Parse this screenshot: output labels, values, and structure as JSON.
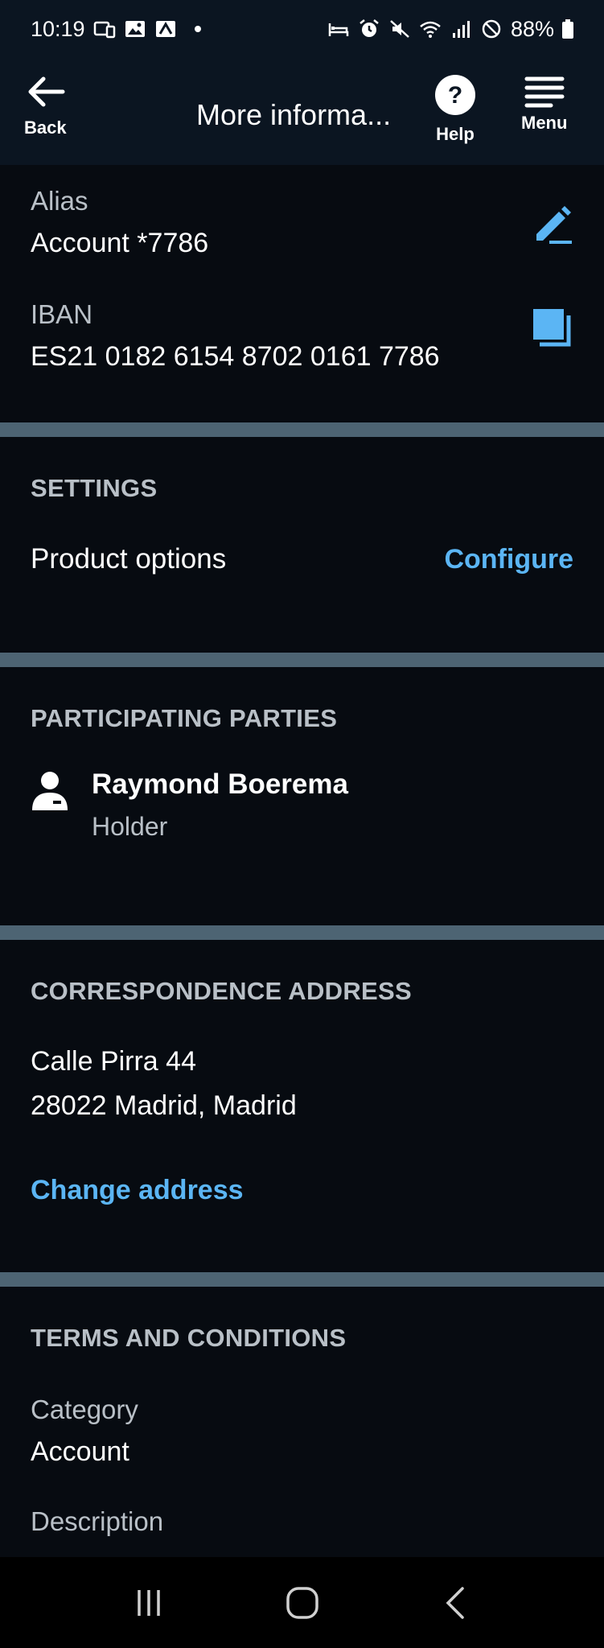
{
  "status_bar": {
    "time": "10:19",
    "battery": "88%"
  },
  "header": {
    "back_label": "Back",
    "title": "More informa...",
    "help_label": "Help",
    "menu_label": "Menu"
  },
  "account": {
    "alias_label": "Alias",
    "alias_value": "Account *7786",
    "iban_label": "IBAN",
    "iban_value": "ES21 0182 6154 8702 0161 7786"
  },
  "settings": {
    "heading": "SETTINGS",
    "product_options_label": "Product options",
    "configure_label": "Configure"
  },
  "parties": {
    "heading": "PARTICIPATING PARTIES",
    "name": "Raymond Boerema",
    "role": "Holder"
  },
  "correspondence": {
    "heading": "CORRESPONDENCE ADDRESS",
    "line1": "Calle Pirra 44",
    "line2": "28022 Madrid, Madrid",
    "change_label": "Change address"
  },
  "terms": {
    "heading": "TERMS AND CONDITIONS",
    "category_label": "Category",
    "category_value": "Account",
    "description_label": "Description"
  },
  "colors": {
    "accent": "#5bb5f4",
    "background": "#070b11",
    "header": "#0b1521",
    "separator": "#4d6473"
  }
}
